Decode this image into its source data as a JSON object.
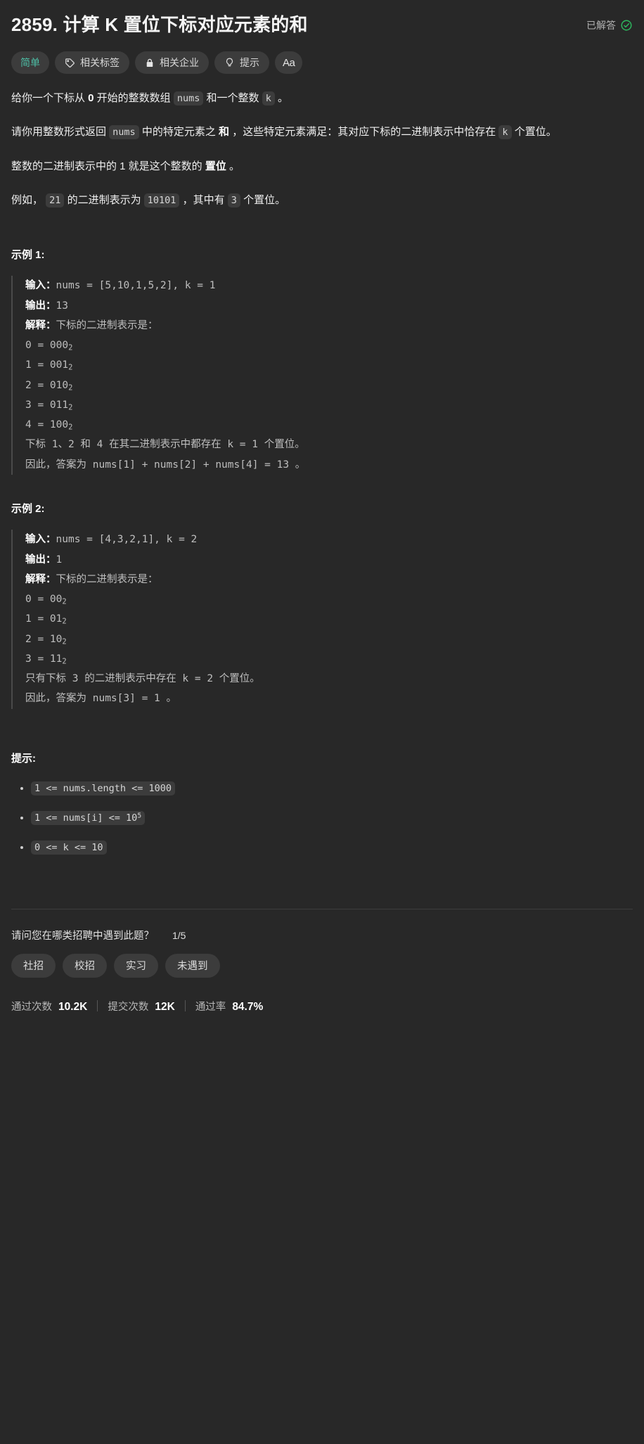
{
  "header": {
    "title": "2859. 计算 K 置位下标对应元素的和",
    "solved_label": "已解答",
    "solved_icon": "circle-check-icon",
    "solved_color": "#2db55d"
  },
  "tags": [
    {
      "label": "简单",
      "icon": null,
      "name": "difficulty-easy",
      "accent": "#4dbda5"
    },
    {
      "label": "相关标签",
      "icon": "tag-icon",
      "name": "related-topics"
    },
    {
      "label": "相关企业",
      "icon": "lock-icon",
      "name": "related-companies"
    },
    {
      "label": "提示",
      "icon": "lightbulb-icon",
      "name": "hints"
    },
    {
      "label": "Aa",
      "icon": "font-size-icon",
      "name": "font-size"
    }
  ],
  "description": {
    "p1": {
      "t1": "给你一个下标从 ",
      "b1": "0",
      "t2": " 开始的整数数组 ",
      "c1": "nums",
      "t3": " 和一个整数 ",
      "c2": "k",
      "t4": " 。"
    },
    "p2": {
      "t1": "请你用整数形式返回 ",
      "c1": "nums",
      "t2": " 中的特定元素之 ",
      "b1": "和",
      "t3": " ，这些特定元素满足：其对应下标的二进制表示中恰存在 ",
      "c2": "k",
      "t4": " 个置位。"
    },
    "p3": {
      "t1": "整数的二进制表示中的 1 就是这个整数的 ",
      "b1": "置位",
      "t2": " 。"
    },
    "p4": {
      "t1": "例如， ",
      "c1": "21",
      "t2": " 的二进制表示为 ",
      "c2": "10101",
      "t3": " ，其中有 ",
      "c3": "3",
      "t4": " 个置位。"
    }
  },
  "examples": [
    {
      "title": "示例 1:",
      "input_label": "输入：",
      "input_value": "nums = [5,10,1,5,2], k = 1",
      "output_label": "输出：",
      "output_value": "13",
      "explain_label": "解释：",
      "explain_intro": "下标的二进制表示是：",
      "binary_lines": [
        {
          "left": "0 = 000",
          "sub": "2"
        },
        {
          "left": "1 = 001",
          "sub": "2"
        },
        {
          "left": "2 = 010",
          "sub": "2"
        },
        {
          "left": "3 = 011",
          "sub": "2"
        },
        {
          "left": "4 = 100",
          "sub": "2"
        }
      ],
      "explain_tail": [
        "下标 1、2 和 4 在其二进制表示中都存在 k = 1 个置位。",
        "因此，答案为 nums[1] + nums[2] + nums[4] = 13 。"
      ]
    },
    {
      "title": "示例 2:",
      "input_label": "输入：",
      "input_value": "nums = [4,3,2,1], k = 2",
      "output_label": "输出：",
      "output_value": "1",
      "explain_label": "解释：",
      "explain_intro": "下标的二进制表示是：",
      "binary_lines": [
        {
          "left": "0 = 00",
          "sub": "2"
        },
        {
          "left": "1 = 01",
          "sub": "2"
        },
        {
          "left": "2 = 10",
          "sub": "2"
        },
        {
          "left": "3 = 11",
          "sub": "2"
        }
      ],
      "explain_tail": [
        "只有下标 3 的二进制表示中存在 k = 2 个置位。",
        "因此，答案为 nums[3] = 1 。"
      ]
    }
  ],
  "constraints": {
    "title": "提示:",
    "items": [
      {
        "text": "1 <= nums.length <= 1000",
        "sup": null
      },
      {
        "text": "1 <= nums[i] <= 10",
        "sup": "5"
      },
      {
        "text": "0 <= k <= 10",
        "sup": null
      }
    ]
  },
  "survey": {
    "question": "请问您在哪类招聘中遇到此题？",
    "counter": "1/5",
    "options": [
      "社招",
      "校招",
      "实习",
      "未遇到"
    ]
  },
  "stats": [
    {
      "label": "通过次数",
      "value": "10.2K"
    },
    {
      "label": "提交次数",
      "value": "12K"
    },
    {
      "label": "通过率",
      "value": "84.7%"
    }
  ]
}
